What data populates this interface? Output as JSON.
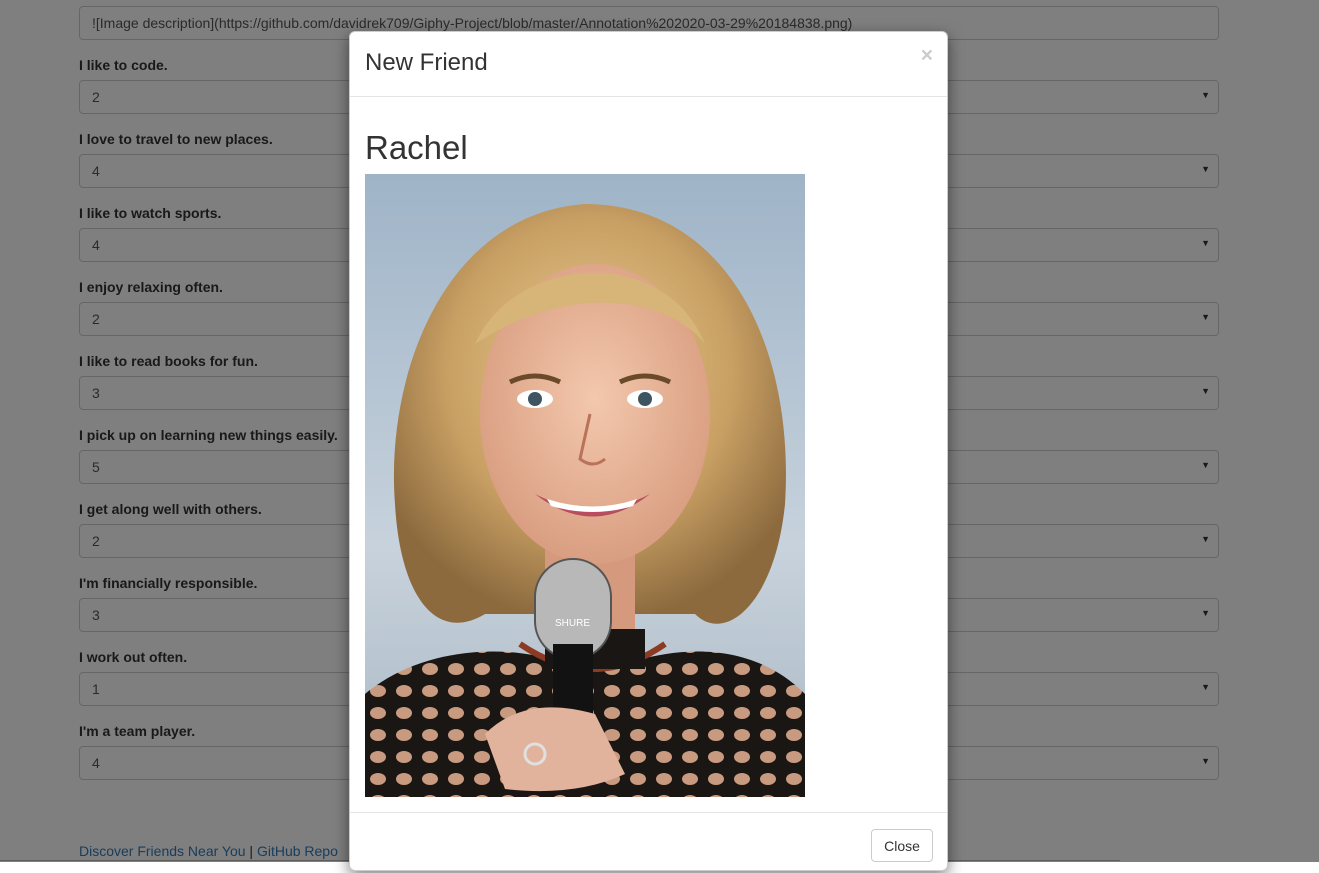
{
  "form": {
    "image_link_value": "![Image description](https://github.com/davidrek709/Giphy-Project/blob/master/Annotation%202020-03-29%20184838.png)",
    "questions": [
      {
        "label": "I like to code.",
        "value": "2"
      },
      {
        "label": "I love to travel to new places.",
        "value": "4"
      },
      {
        "label": "I like to watch sports.",
        "value": "4"
      },
      {
        "label": "I enjoy relaxing often.",
        "value": "2"
      },
      {
        "label": "I like to read books for fun.",
        "value": "3"
      },
      {
        "label": "I pick up on learning new things easily.",
        "value": "5"
      },
      {
        "label": "I get along well with others.",
        "value": "2"
      },
      {
        "label": "I'm financially responsible.",
        "value": "3"
      },
      {
        "label": "I work out often.",
        "value": "1"
      },
      {
        "label": "I'm a team player.",
        "value": "4"
      }
    ]
  },
  "footer": {
    "link1": "Discover Friends Near You",
    "separator": "|",
    "link2": "GitHub Repo"
  },
  "modal": {
    "title": "New Friend",
    "close_glyph": "×",
    "friend_name": "Rachel",
    "close_button": "Close"
  },
  "icons": {
    "select_caret": "caret-down-icon"
  },
  "colors": {
    "link": "#337ab7",
    "backdrop": "rgba(0,0,0,0.5)"
  }
}
